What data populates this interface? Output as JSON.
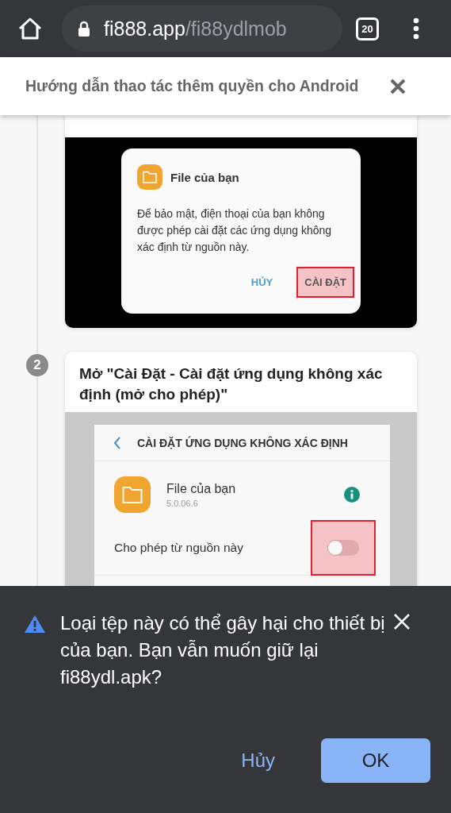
{
  "browser": {
    "url_host": "fi888.app",
    "url_path": "/fi88ydlmob",
    "tab_count": "20"
  },
  "header": {
    "title": "Hướng dẫn thao tác thêm quyền cho Android"
  },
  "steps": [
    {
      "kind": "install_dialog",
      "app_name": "File của bạn",
      "message": "Để bảo mật, điện thoại của bạn không được phép cài đặt các ứng dụng không xác định từ nguồn này.",
      "buttons": [
        {
          "label": "HỦY",
          "highlighted": false
        },
        {
          "label": "CÀI ĐẶT",
          "highlighted": true
        }
      ]
    },
    {
      "kind": "settings",
      "number": "2",
      "title": "Mở \"Cài Đặt - Cài đặt ứng dụng không xác định (mở cho phép)\"",
      "screen_title": "CÀI ĐẶT ỨNG DỤNG KHÔNG XÁC ĐỊNH",
      "app_name": "File của bạn",
      "version": "5.0.06.6",
      "toggle_label": "Cho phép từ nguồn này",
      "on": false,
      "highlighted": true
    }
  ],
  "download_warning": {
    "message": "Loại tệp này có thể gây hại cho thiết bị của bạn. Bạn vẫn muốn giữ lại fi88ydl.apk?",
    "buttons": [
      {
        "label": "Hủy",
        "kind": "text"
      },
      {
        "label": "OK",
        "kind": "filled"
      }
    ]
  }
}
